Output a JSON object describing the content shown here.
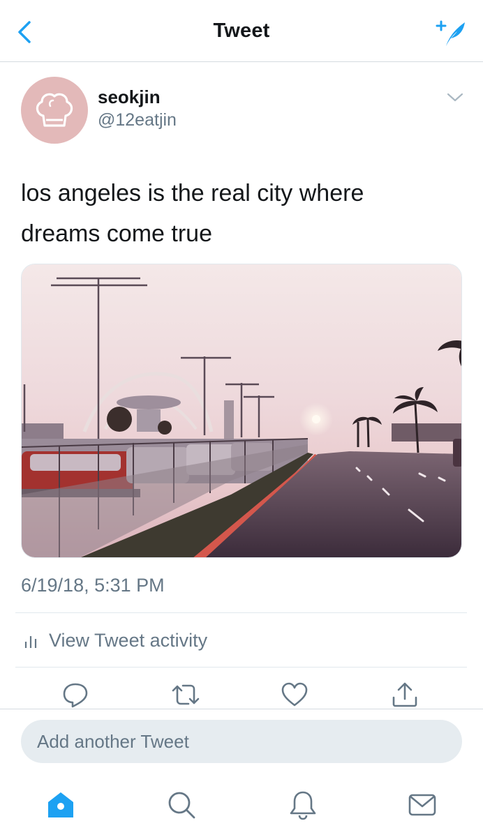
{
  "header": {
    "title": "Tweet",
    "back_icon": "back-chevron-icon",
    "compose_icon": "compose-tweet-icon"
  },
  "author": {
    "display_name": "seokjin",
    "handle": "@12eatjin",
    "avatar_icon": "chef-hat-icon",
    "avatar_color": "#e3b9b9"
  },
  "tweet": {
    "text_line1": "los angeles is the real city where",
    "text_line2": "dreams come true",
    "timestamp": "6/19/18, 5:31 PM"
  },
  "activity": {
    "label": "View Tweet activity",
    "icon": "bar-chart-icon"
  },
  "actions": [
    "reply-icon",
    "retweet-icon",
    "like-icon",
    "share-icon"
  ],
  "reply": {
    "placeholder": "Add another Tweet"
  },
  "tabs": [
    "home-icon",
    "search-icon",
    "notifications-icon",
    "messages-icon"
  ],
  "colors": {
    "accent": "#1da1f2",
    "secondary_text": "#657786",
    "divider": "#e1e8ed"
  }
}
